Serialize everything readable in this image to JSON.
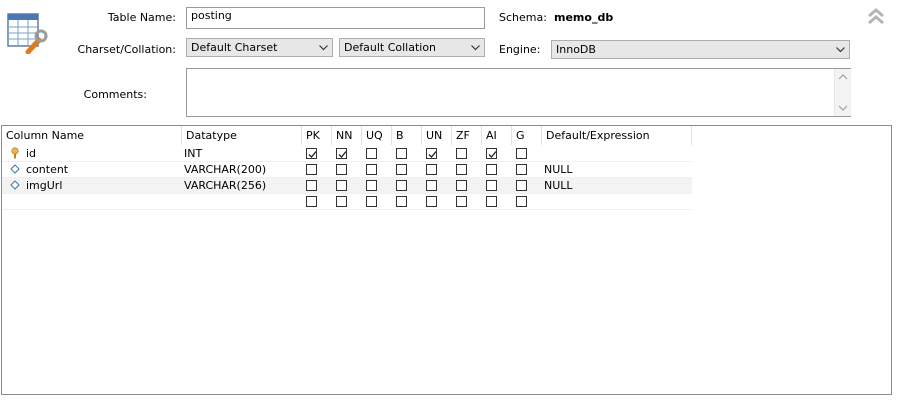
{
  "form": {
    "table_name_label": "Table Name:",
    "table_name_value": "posting",
    "schema_label": "Schema:",
    "schema_value": "memo_db",
    "charset_label": "Charset/Collation:",
    "charset_value": "Default Charset",
    "collation_value": "Default Collation",
    "engine_label": "Engine:",
    "engine_value": "InnoDB",
    "comments_label": "Comments:",
    "comments_value": ""
  },
  "columns_grid": {
    "headers": [
      "Column Name",
      "Datatype",
      "PK",
      "NN",
      "UQ",
      "B",
      "UN",
      "ZF",
      "AI",
      "G",
      "Default/Expression"
    ],
    "rows": [
      {
        "name": "id",
        "icon": "key-icon",
        "datatype": "INT",
        "flags": [
          true,
          true,
          false,
          false,
          true,
          false,
          true,
          false
        ],
        "default": ""
      },
      {
        "name": "content",
        "icon": "diamond-icon",
        "datatype": "VARCHAR(200)",
        "flags": [
          false,
          false,
          false,
          false,
          false,
          false,
          false,
          false
        ],
        "default": "NULL"
      },
      {
        "name": "imgUrl",
        "icon": "diamond-icon",
        "datatype": "VARCHAR(256)",
        "flags": [
          false,
          false,
          false,
          false,
          false,
          false,
          false,
          false
        ],
        "default": "NULL"
      },
      {
        "name": "",
        "icon": "",
        "datatype": "",
        "flags": [
          false,
          false,
          false,
          false,
          false,
          false,
          false,
          false
        ],
        "default": ""
      }
    ]
  },
  "icons": {
    "table_editor": "table-wrench-icon",
    "collapse": "double-chevron-up-icon",
    "dropdown": "chevron-down-icon"
  },
  "colors": {
    "key_icon": "#e8b84a",
    "diamond_icon": "#3a7aa0",
    "alt_row": "#f3f3f3"
  }
}
